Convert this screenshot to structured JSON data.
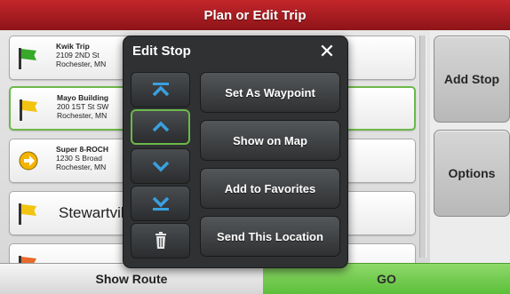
{
  "header": {
    "title": "Plan or Edit Trip"
  },
  "stops": [
    {
      "icon": "green-flag-icon",
      "lines": [
        "Kwik Trip",
        "2109 2ND St",
        "Rochester, MN"
      ]
    },
    {
      "icon": "yellow-flag-icon",
      "lines": [
        "Mayo Building",
        "200 1ST St SW",
        "Rochester, MN"
      ],
      "selected": true
    },
    {
      "icon": "yellow-arrow-icon",
      "lines": [
        "Super 8-ROCH",
        "1230 S Broad",
        "Rochester, MN"
      ]
    },
    {
      "icon": "yellow-flag-icon",
      "big": "Stewartville"
    }
  ],
  "side": {
    "add_stop": "Add Stop",
    "options": "Options"
  },
  "bottom": {
    "show_route": "Show Route",
    "go": "GO"
  },
  "dialog": {
    "title": "Edit Stop",
    "close_symbol": "✕",
    "actions": [
      "Set As Waypoint",
      "Show on Map",
      "Add to Favorites",
      "Send This Location"
    ],
    "move_buttons": [
      "move-to-top-icon",
      "move-up-icon",
      "move-down-icon",
      "move-to-bottom-icon",
      "trash-icon"
    ]
  },
  "colors": {
    "title_bar": "#b01e23",
    "go_button": "#6ccb47",
    "selected_border": "#6cb84a",
    "dialog_bg": "#2f3133",
    "move_arrow": "#39a0e0"
  }
}
